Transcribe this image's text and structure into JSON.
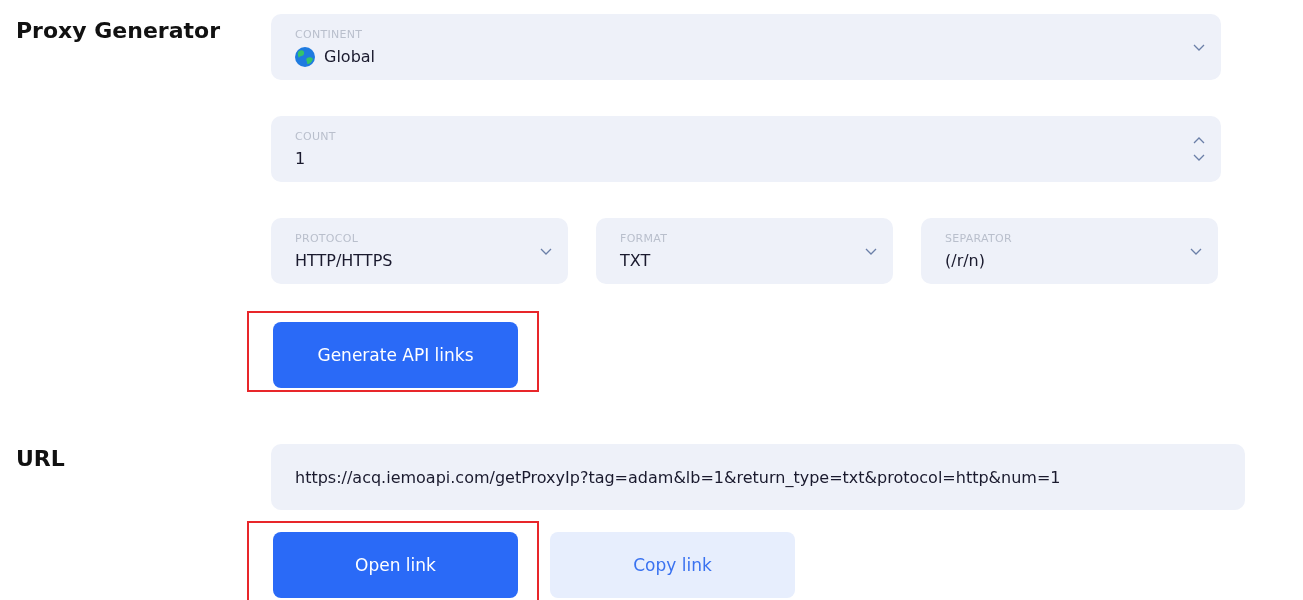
{
  "sections": [
    {
      "title": "Proxy Generator",
      "fields": [
        {
          "kind": "select",
          "label": "CONTINENT",
          "value": "Global"
        },
        {
          "kind": "number",
          "label": "COUNT",
          "value": "1"
        },
        {
          "kind": "select",
          "label": "PROTOCOL",
          "value": "HTTP/HTTPS"
        },
        {
          "kind": "select",
          "label": "FORMAT",
          "value": "TXT"
        },
        {
          "kind": "select",
          "label": "SEPARATOR",
          "value": "(/r/n)"
        }
      ],
      "buttons": [
        {
          "label": "Generate API links",
          "kind": "primary",
          "highlighted": true
        }
      ]
    },
    {
      "title": "URL",
      "fields": [
        {
          "kind": "text",
          "value": "https://acq.iemoapi.com/getProxyIp?tag=adam&lb=1&return_type=txt&protocol=http&num=1"
        }
      ],
      "buttons": [
        {
          "label": "Open link",
          "kind": "primary",
          "highlighted": true
        },
        {
          "label": "Copy link",
          "kind": "secondary",
          "highlighted": false
        }
      ]
    }
  ]
}
